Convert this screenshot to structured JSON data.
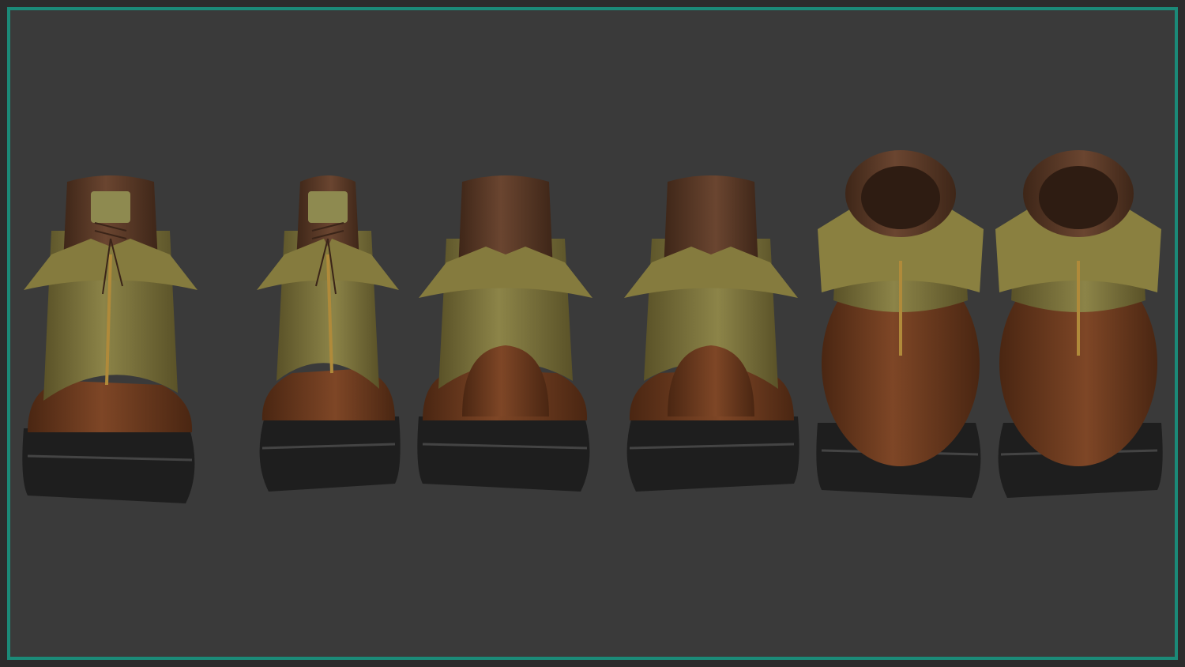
{
  "scene": {
    "subject": "boots",
    "views": [
      "front-left",
      "front-right",
      "back-left",
      "back-right",
      "top-left",
      "top-right"
    ]
  },
  "colors": {
    "background": "#3a3a3a",
    "border": "#1b8a78",
    "olive_leather": "#7a7038",
    "brown_leather": "#6b3a1e",
    "cuff_fur": "#5a3a26",
    "sole": "#1e1e1e",
    "zipper": "#b08a3a"
  }
}
